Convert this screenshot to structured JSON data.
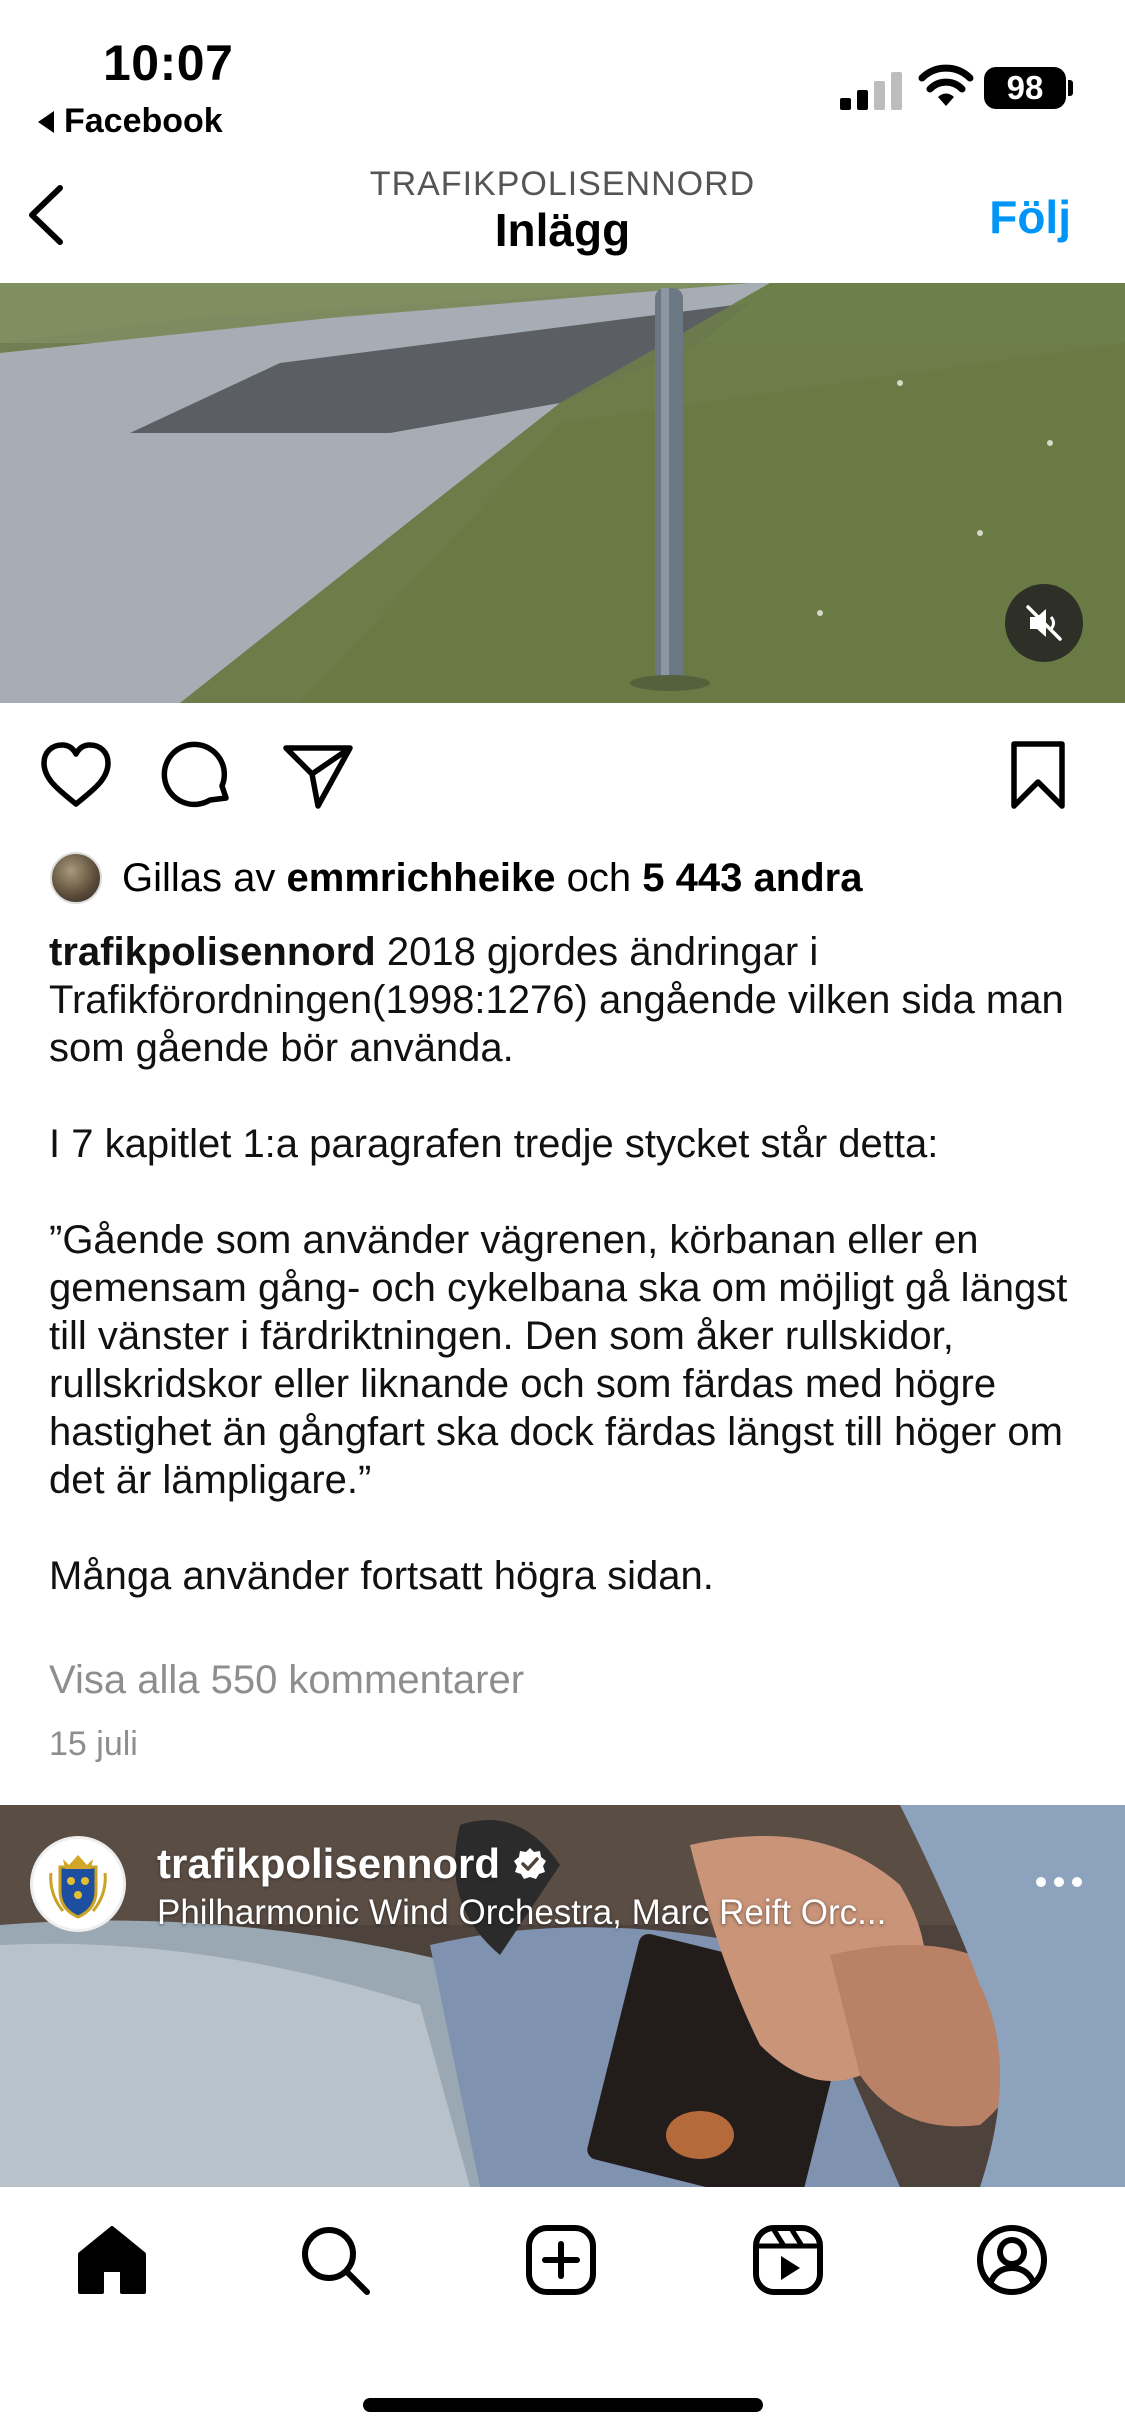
{
  "status_bar": {
    "time": "10:07",
    "back_app": "Facebook",
    "battery": "98"
  },
  "header": {
    "subtitle": "TRAFIKPOLISENNORD",
    "title": "Inlägg",
    "follow_label": "Följ"
  },
  "post": {
    "likes": {
      "prefix": "Gillas av",
      "user": "emmrichheike",
      "connector": "och",
      "others": "5 443 andra"
    },
    "caption": {
      "username": "trafikpolisennord",
      "paragraphs": [
        "2018 gjordes ändringar i Trafikförordningen(1998:1276) angående vilken sida man som gående bör använda.",
        "I 7 kapitlet 1:a paragrafen tredje stycket står detta:",
        "”Gående som använder vägrenen, körbanan eller en gemensam gång- och cykelbana ska om möjligt gå längst till vänster i färdriktningen. Den som åker rullskidor, rullskridskor eller liknande och som färdas med högre hastighet än gångfart ska dock färdas längst till höger om det är lämpligare.”",
        "Många använder fortsatt högra sidan."
      ]
    },
    "view_comments": "Visa alla 550 kommentarer",
    "date": "15 juli"
  },
  "next_post": {
    "username": "trafikpolisennord",
    "music": "Philharmonic Wind Orchestra, Marc Reift Orc..."
  },
  "colors": {
    "accent": "#0095f6",
    "muted": "#8e8e8e"
  }
}
